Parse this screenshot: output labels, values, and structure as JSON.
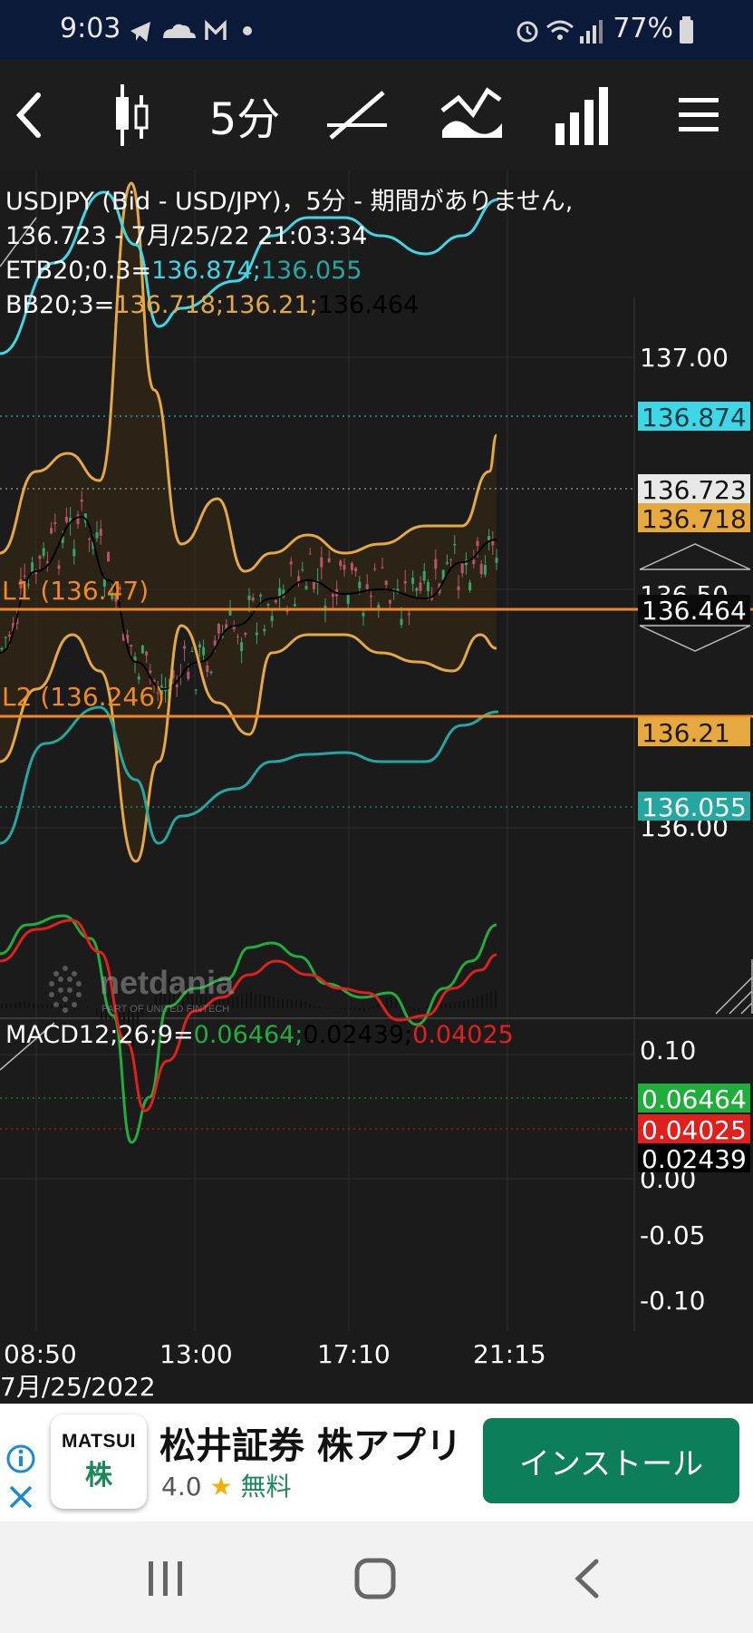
{
  "status_bar": {
    "time": "9:03",
    "battery": "77%",
    "icons": [
      "telegram-icon",
      "cloud-icon",
      "gmail-icon",
      "dot-icon",
      "alarm-icon",
      "wifi-icon",
      "signal-icon",
      "battery-icon"
    ]
  },
  "toolbar": {
    "back_icon": "chevron-left-icon",
    "candle_icon": "candlestick-icon",
    "interval": "5分",
    "drawing_icon": "draw-line-icon",
    "indicator_icon": "indicator-icon",
    "chart_type_icon": "bar-chart-icon",
    "menu_icon": "hamburger-menu-icon"
  },
  "chart": {
    "header_line1": "USDJPY (Bid - USD/JPY)，5分 - 期間がありません,",
    "header_line2": "136.723 - 7月/25/22 21:03:34",
    "etb_prefix": "ETB20;0.3=",
    "etb_upper": "136.874;",
    "etb_lower": "136.055",
    "bb_prefix": "BB20;3=",
    "bb_upper": "136.718;",
    "bb_lower": "136.21;",
    "bb_mid": "136.464",
    "line_l1": "L1 (136.47)",
    "line_l2": "L2 (136.246)",
    "watermark": "netdania",
    "watermark_sub": "PART OF  UNITED FINTECH",
    "price_ticks": [
      "137.00",
      "136.50",
      "136.00"
    ],
    "price_tags": {
      "etb_upper": "136.874",
      "last": "136.723",
      "bb_upper": "136.718",
      "bb_mid": "136.464",
      "bb_lower": "136.21",
      "etb_lower": "136.055"
    },
    "macd_prefix": "MACD12;26;9=",
    "macd_value": "0.06464;",
    "macd_hist": "0.02439;",
    "macd_signal": "0.04025",
    "macd_ticks": [
      "0.10",
      "0.00",
      "-0.05",
      "-0.10"
    ],
    "macd_tags": {
      "macd": "0.06464",
      "signal": "0.04025",
      "hist": "0.02439"
    },
    "time_ticks": [
      "08:50",
      "13:00",
      "17:10",
      "21:15"
    ],
    "date_label": "7月/25/2022",
    "colors": {
      "etb": "#3fd6e6",
      "etb_lower": "#24a7a0",
      "bb": "#e6a940",
      "line": "#f08a1c",
      "macd": "#1fae3c",
      "signal": "#e0201c",
      "up": "#3aa36a",
      "down": "#b8556a"
    }
  },
  "ad": {
    "logo_line1": "MATSUI",
    "logo_line2": "株",
    "title": "松井証券 株アプリ",
    "rating": "4.0",
    "star": "★",
    "free": "無料",
    "install": "インストール",
    "info_icon": "info-icon",
    "close_icon": "close-icon"
  },
  "nav": {
    "recents_icon": "recents-icon",
    "home_icon": "home-icon",
    "back_icon": "back-icon"
  }
}
